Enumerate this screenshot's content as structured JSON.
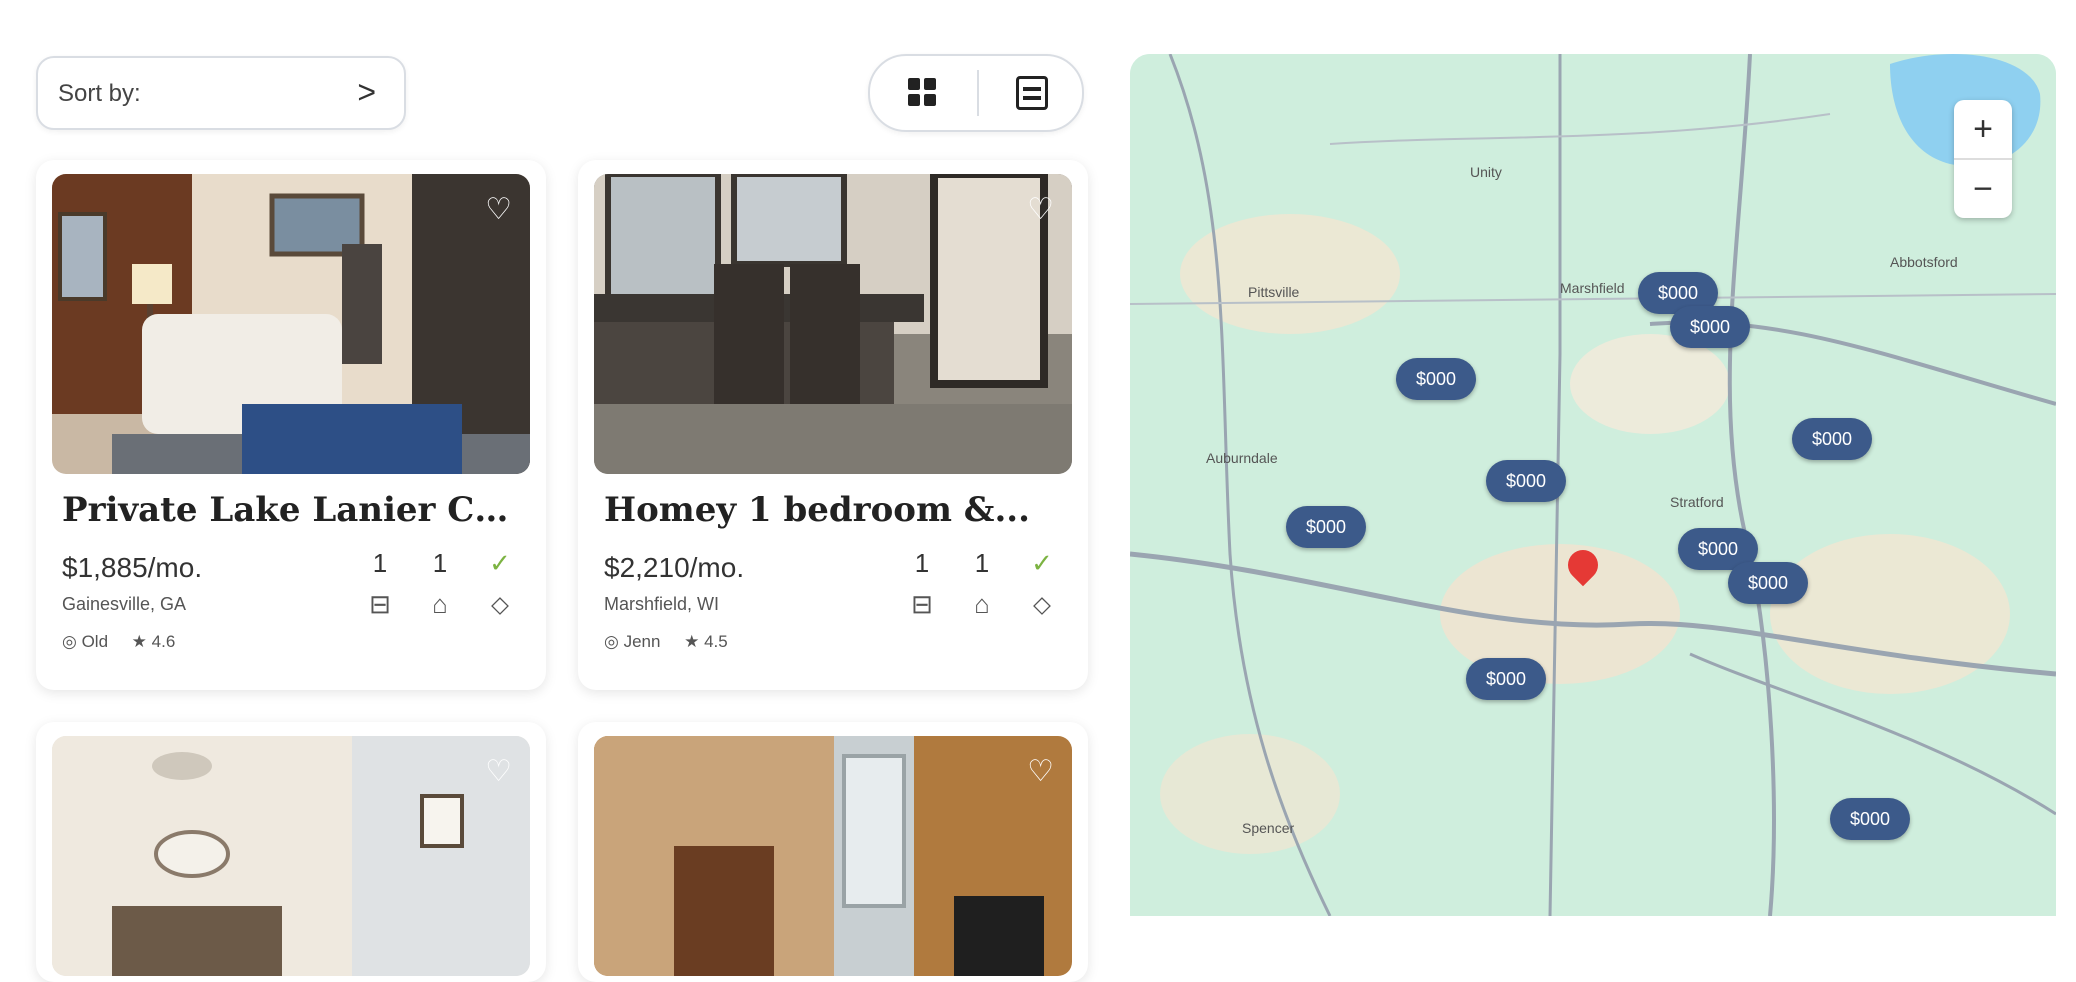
{
  "toolbar": {
    "sort_label": "Sort by:",
    "sort_chevron": ">",
    "view_options": [
      "grid-icon",
      "list-icon"
    ]
  },
  "listings": [
    {
      "title": "Private Lake Lanier Condo",
      "price": "$1,885/mo.",
      "location": "Gainesville, GA",
      "beds": "1",
      "baths": "1",
      "pets": "✓",
      "meta_a": "Old",
      "rating": "4.6"
    },
    {
      "title": "Homey 1 bedroom &...",
      "price": "$2,210/mo.",
      "location": "Marshfield, WI",
      "beds": "1",
      "baths": "1",
      "pets": "✓",
      "meta_a": "Jenn",
      "rating": "4.5"
    },
    {
      "title": "",
      "price": "",
      "location": ""
    },
    {
      "title": "",
      "price": "",
      "location": ""
    }
  ],
  "map": {
    "zoom_in": "+",
    "zoom_out": "−",
    "price_pins": [
      "$000",
      "$000",
      "$000",
      "$000",
      "$000",
      "$000",
      "$000",
      "$000",
      "$000",
      "$000"
    ],
    "towns": [
      "Pittsville",
      "Marshfield",
      "Auburndale",
      "Stratford",
      "Abbotsford",
      "Unity",
      "Spencer"
    ],
    "colors": {
      "land": "#cfeedd",
      "water": "#8fd0f0",
      "pin_bg": "#3c5a8a",
      "road": "#9aa5b1"
    }
  }
}
